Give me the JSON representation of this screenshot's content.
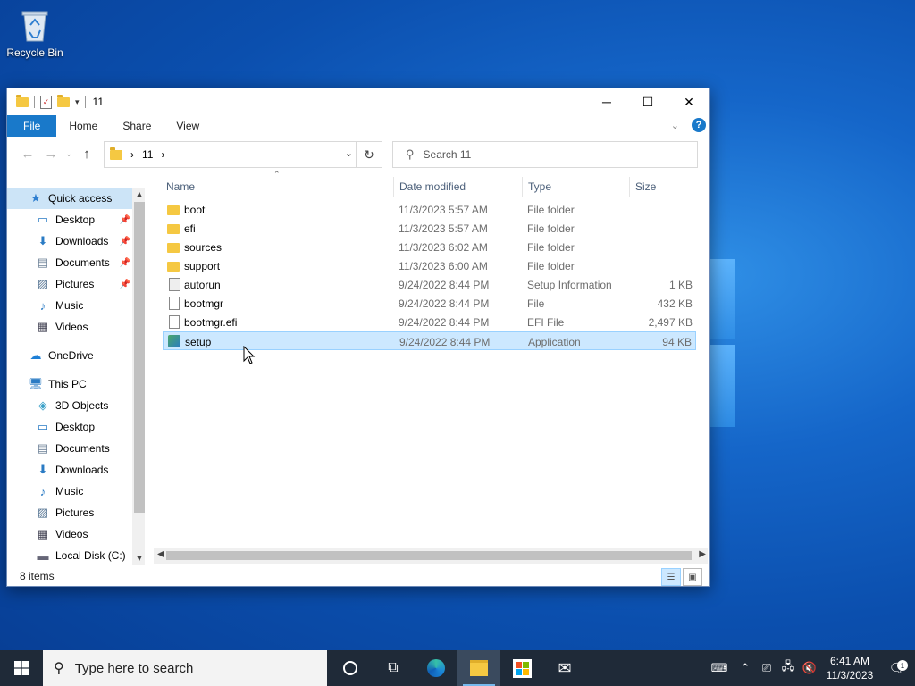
{
  "desktop": {
    "icons": [
      {
        "label": "Recycle Bin",
        "icon": "recycle-bin-icon"
      }
    ]
  },
  "window": {
    "title": "11",
    "controls": {
      "minimize": "─",
      "maximize": "☐",
      "close": "✕"
    },
    "ribbon_tabs": [
      "File",
      "Home",
      "Share",
      "View"
    ],
    "address": {
      "crumb": "11",
      "separator": "›"
    },
    "search": {
      "placeholder": "Search 11"
    },
    "nav_pane": [
      {
        "label": "Quick access",
        "icon": "star-icon",
        "selected": true,
        "indent": 0
      },
      {
        "label": "Desktop",
        "icon": "desktop-icon",
        "pinned": true,
        "indent": 1
      },
      {
        "label": "Downloads",
        "icon": "download-icon",
        "pinned": true,
        "indent": 1
      },
      {
        "label": "Documents",
        "icon": "documents-icon",
        "pinned": true,
        "indent": 1
      },
      {
        "label": "Pictures",
        "icon": "pictures-icon",
        "pinned": true,
        "indent": 1
      },
      {
        "label": "Music",
        "icon": "music-icon",
        "indent": 1
      },
      {
        "label": "Videos",
        "icon": "videos-icon",
        "indent": 1
      },
      {
        "label": "OneDrive",
        "icon": "cloud-icon",
        "indent": 0,
        "gap": true
      },
      {
        "label": "This PC",
        "icon": "pc-icon",
        "indent": 0,
        "gap": true
      },
      {
        "label": "3D Objects",
        "icon": "cube-icon",
        "indent": 1
      },
      {
        "label": "Desktop",
        "icon": "desktop-icon",
        "indent": 1
      },
      {
        "label": "Documents",
        "icon": "documents-icon",
        "indent": 1
      },
      {
        "label": "Downloads",
        "icon": "download-icon",
        "indent": 1
      },
      {
        "label": "Music",
        "icon": "music-icon",
        "indent": 1
      },
      {
        "label": "Pictures",
        "icon": "pictures-icon",
        "indent": 1
      },
      {
        "label": "Videos",
        "icon": "videos-icon",
        "indent": 1
      },
      {
        "label": "Local Disk (C:)",
        "icon": "drive-icon",
        "indent": 1
      }
    ],
    "columns": {
      "name": "Name",
      "date": "Date modified",
      "type": "Type",
      "size": "Size"
    },
    "files": [
      {
        "name": "boot",
        "date": "11/3/2023 5:57 AM",
        "type": "File folder",
        "size": "",
        "icon": "folder-icon"
      },
      {
        "name": "efi",
        "date": "11/3/2023 5:57 AM",
        "type": "File folder",
        "size": "",
        "icon": "folder-icon"
      },
      {
        "name": "sources",
        "date": "11/3/2023 6:02 AM",
        "type": "File folder",
        "size": "",
        "icon": "folder-icon"
      },
      {
        "name": "support",
        "date": "11/3/2023 6:00 AM",
        "type": "File folder",
        "size": "",
        "icon": "folder-icon"
      },
      {
        "name": "autorun",
        "date": "9/24/2022 8:44 PM",
        "type": "Setup Information",
        "size": "1 KB",
        "icon": "setup-info-icon"
      },
      {
        "name": "bootmgr",
        "date": "9/24/2022 8:44 PM",
        "type": "File",
        "size": "432 KB",
        "icon": "file-icon"
      },
      {
        "name": "bootmgr.efi",
        "date": "9/24/2022 8:44 PM",
        "type": "EFI File",
        "size": "2,497 KB",
        "icon": "file-icon"
      },
      {
        "name": "setup",
        "date": "9/24/2022 8:44 PM",
        "type": "Application",
        "size": "94 KB",
        "icon": "setup-app-icon",
        "selected": true
      }
    ],
    "status": "8 items"
  },
  "taskbar": {
    "search_placeholder": "Type here to search",
    "time": "6:41 AM",
    "date": "11/3/2023",
    "notification_count": "1",
    "colors": {
      "bar": "#1f2a38",
      "accent": "#76b9ed"
    }
  }
}
